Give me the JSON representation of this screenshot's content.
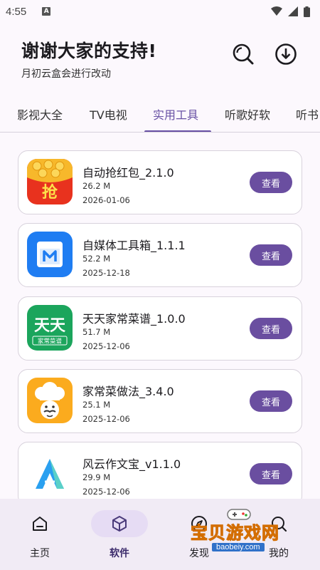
{
  "status": {
    "time": "4:55",
    "notification_glyph": "A"
  },
  "header": {
    "title": "谢谢大家的支持!",
    "subtitle": "月初云盒会进行改动"
  },
  "tabs": [
    {
      "label": "影视大全"
    },
    {
      "label": "TV电视"
    },
    {
      "label": "实用工具",
      "active": true
    },
    {
      "label": "听歌好软"
    },
    {
      "label": "听书"
    }
  ],
  "apps": [
    {
      "name": "自动抢红包_2.1.0",
      "size": "26.2 M",
      "date": "2026-01-06",
      "button": "查看",
      "icon": "red-envelope-icon"
    },
    {
      "name": "自媒体工具箱_1.1.1",
      "size": "52.2 M",
      "date": "2025-12-18",
      "button": "查看",
      "icon": "media-toolbox-icon"
    },
    {
      "name": "天天家常菜谱_1.0.0",
      "size": "51.7 M",
      "date": "2025-12-06",
      "button": "查看",
      "icon": "recipe-icon",
      "icon_text": "天天",
      "icon_subtext": "家常菜谱"
    },
    {
      "name": "家常菜做法_3.4.0",
      "size": "25.1 M",
      "date": "2025-12-06",
      "button": "查看",
      "icon": "chef-icon"
    },
    {
      "name": "风云作文宝_v1.1.0",
      "size": "29.9 M",
      "date": "2025-12-06",
      "button": "查看",
      "icon": "essay-icon"
    }
  ],
  "nav": [
    {
      "label": "主页",
      "icon": "home-icon"
    },
    {
      "label": "软件",
      "icon": "software-icon",
      "active": true
    },
    {
      "label": "发现",
      "icon": "discover-icon"
    },
    {
      "label": "我的",
      "icon": "search-icon"
    }
  ],
  "watermark": {
    "text": "宝贝游戏网",
    "url": "baobeiy.com"
  },
  "colors": {
    "accent": "#6750a4",
    "button": "#6a4ea0",
    "nav_bg": "#f1ebf5",
    "page_bg": "#fcf8fd"
  }
}
